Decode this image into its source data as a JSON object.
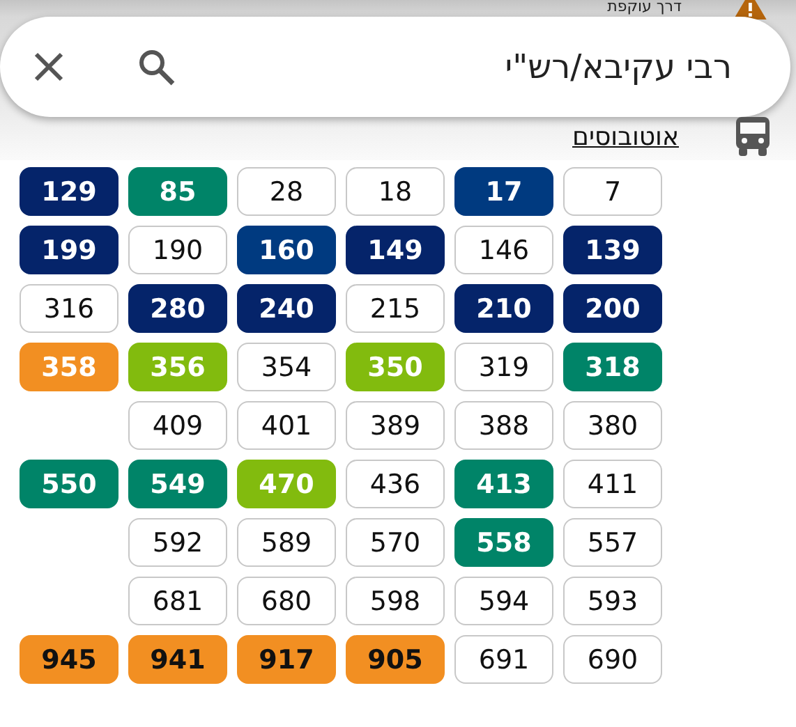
{
  "alert": {
    "text": "דרך עוקפת"
  },
  "search": {
    "value": "רבי עקיבא/רש\"י"
  },
  "lines_link": {
    "label": "אוטובוסים"
  },
  "route_rows": [
    [
      {
        "number": "129",
        "kind": "filled",
        "color": "#05246a"
      },
      {
        "number": "85",
        "kind": "filled",
        "color": "#008468"
      },
      {
        "number": "28",
        "kind": "outlined"
      },
      {
        "number": "18",
        "kind": "outlined"
      },
      {
        "number": "17",
        "kind": "filled",
        "color": "#003a80"
      },
      {
        "number": "7",
        "kind": "outlined"
      }
    ],
    [
      {
        "number": "199",
        "kind": "filled",
        "color": "#05246a"
      },
      {
        "number": "190",
        "kind": "outlined"
      },
      {
        "number": "160",
        "kind": "filled",
        "color": "#003a80"
      },
      {
        "number": "149",
        "kind": "filled",
        "color": "#05246a"
      },
      {
        "number": "146",
        "kind": "outlined"
      },
      {
        "number": "139",
        "kind": "filled",
        "color": "#05246a"
      }
    ],
    [
      {
        "number": "316",
        "kind": "outlined"
      },
      {
        "number": "280",
        "kind": "filled",
        "color": "#05246a"
      },
      {
        "number": "240",
        "kind": "filled",
        "color": "#05246a"
      },
      {
        "number": "215",
        "kind": "outlined"
      },
      {
        "number": "210",
        "kind": "filled",
        "color": "#05246a"
      },
      {
        "number": "200",
        "kind": "filled",
        "color": "#05246a"
      }
    ],
    [
      {
        "number": "358",
        "kind": "filled",
        "color": "#f28f22"
      },
      {
        "number": "356",
        "kind": "filled",
        "color": "#82bb0e"
      },
      {
        "number": "354",
        "kind": "outlined"
      },
      {
        "number": "350",
        "kind": "filled",
        "color": "#82bb0e"
      },
      {
        "number": "319",
        "kind": "outlined"
      },
      {
        "number": "318",
        "kind": "filled",
        "color": "#008468"
      }
    ],
    [
      {
        "number": "409",
        "kind": "outlined"
      },
      {
        "number": "401",
        "kind": "outlined"
      },
      {
        "number": "389",
        "kind": "outlined"
      },
      {
        "number": "388",
        "kind": "outlined"
      },
      {
        "number": "380",
        "kind": "outlined"
      }
    ],
    [
      {
        "number": "550",
        "kind": "filled",
        "color": "#008468"
      },
      {
        "number": "549",
        "kind": "filled",
        "color": "#008468"
      },
      {
        "number": "470",
        "kind": "filled",
        "color": "#82bb0e"
      },
      {
        "number": "436",
        "kind": "outlined"
      },
      {
        "number": "413",
        "kind": "filled",
        "color": "#008468"
      },
      {
        "number": "411",
        "kind": "outlined"
      }
    ],
    [
      {
        "number": "592",
        "kind": "outlined"
      },
      {
        "number": "589",
        "kind": "outlined"
      },
      {
        "number": "570",
        "kind": "outlined"
      },
      {
        "number": "558",
        "kind": "filled",
        "color": "#008468"
      },
      {
        "number": "557",
        "kind": "outlined"
      }
    ],
    [
      {
        "number": "681",
        "kind": "outlined"
      },
      {
        "number": "680",
        "kind": "outlined"
      },
      {
        "number": "598",
        "kind": "outlined"
      },
      {
        "number": "594",
        "kind": "outlined"
      },
      {
        "number": "593",
        "kind": "outlined"
      }
    ],
    [
      {
        "number": "945",
        "kind": "filled-dark",
        "color": "#f28f22"
      },
      {
        "number": "941",
        "kind": "filled-dark",
        "color": "#f28f22"
      },
      {
        "number": "917",
        "kind": "filled-dark",
        "color": "#f28f22"
      },
      {
        "number": "905",
        "kind": "filled-dark",
        "color": "#f28f22"
      },
      {
        "number": "691",
        "kind": "outlined"
      },
      {
        "number": "690",
        "kind": "outlined"
      }
    ]
  ]
}
